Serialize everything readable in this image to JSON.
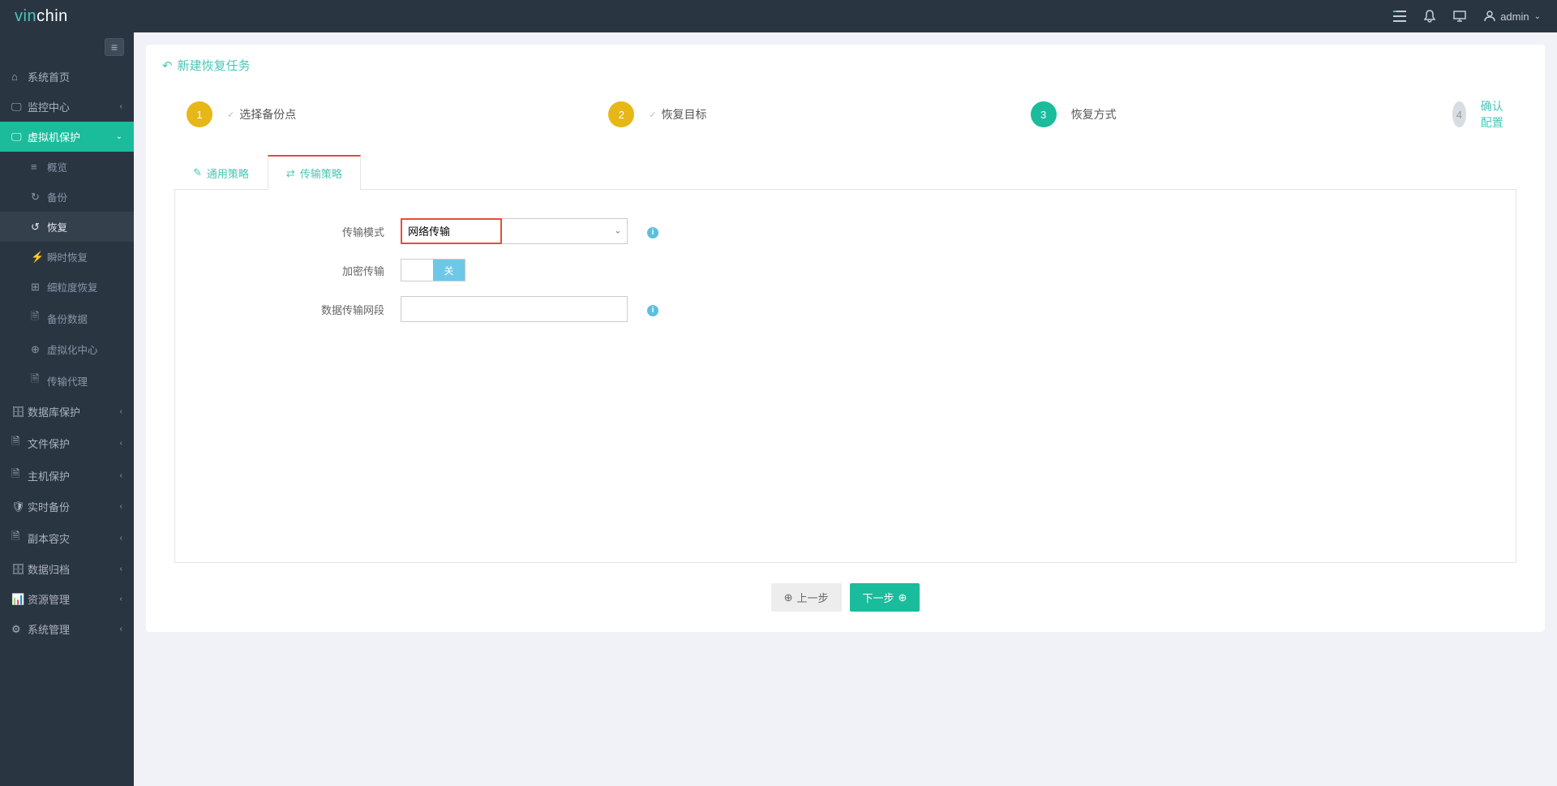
{
  "brand": {
    "part1": "vin",
    "part2": "chin"
  },
  "user": {
    "name": "admin"
  },
  "sidebar": {
    "items": [
      {
        "label": "系统首页"
      },
      {
        "label": "监控中心"
      },
      {
        "label": "虚拟机保护"
      },
      {
        "label": "数据库保护"
      },
      {
        "label": "文件保护"
      },
      {
        "label": "主机保护"
      },
      {
        "label": "实时备份"
      },
      {
        "label": "副本容灾"
      },
      {
        "label": "数据归档"
      },
      {
        "label": "资源管理"
      },
      {
        "label": "系统管理"
      }
    ],
    "vm_sub": [
      {
        "label": "概览"
      },
      {
        "label": "备份"
      },
      {
        "label": "恢复"
      },
      {
        "label": "瞬时恢复"
      },
      {
        "label": "细粒度恢复"
      },
      {
        "label": "备份数据"
      },
      {
        "label": "虚拟化中心"
      },
      {
        "label": "传输代理"
      }
    ]
  },
  "page": {
    "title": "新建恢复任务"
  },
  "steps": [
    {
      "num": "1",
      "label": "选择备份点"
    },
    {
      "num": "2",
      "label": "恢复目标"
    },
    {
      "num": "3",
      "label": "恢复方式"
    },
    {
      "num": "4",
      "label": "确认配置"
    }
  ],
  "tabs": [
    {
      "label": "通用策略"
    },
    {
      "label": "传输策略"
    }
  ],
  "form": {
    "transfer_mode_label": "传输模式",
    "transfer_mode_value": "网络传输",
    "encrypt_label": "加密传输",
    "encrypt_off": "关",
    "network_segment_label": "数据传输网段",
    "network_segment_value": ""
  },
  "buttons": {
    "prev": "上一步",
    "next": "下一步"
  }
}
